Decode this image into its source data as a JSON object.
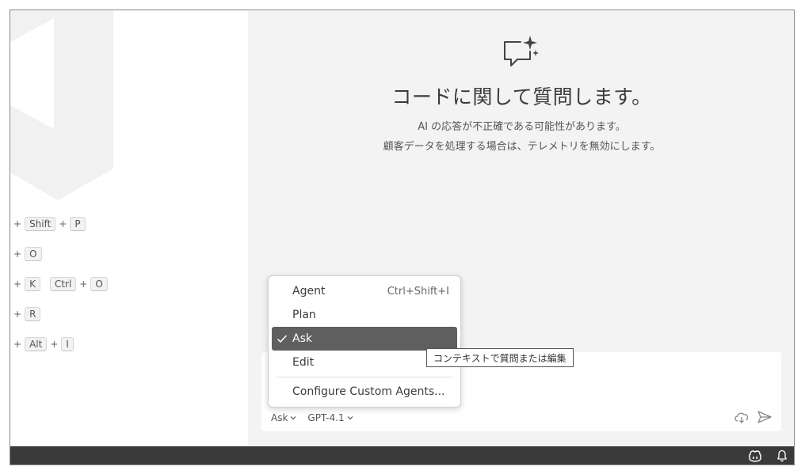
{
  "shortcuts": [
    {
      "items": [
        "+",
        "Shift",
        "+",
        "P"
      ]
    },
    {
      "items": [
        "+",
        "O"
      ]
    },
    {
      "items": [
        "+",
        "K",
        "Ctrl",
        "+",
        "O"
      ]
    },
    {
      "items": [
        "+",
        "R"
      ]
    },
    {
      "items": [
        "+",
        "Alt",
        "+",
        "I"
      ]
    }
  ],
  "chat": {
    "title": "コードに関して質問します。",
    "subtitle_1": "AI の応答が不正確である可能性があります。",
    "subtitle_2": "顧客データを処理する場合は、テレメトリを無効にします。",
    "mode_picker": "Ask",
    "model_picker": "GPT-4.1"
  },
  "mode_menu": {
    "items": [
      {
        "label": "Agent",
        "shortcut": "Ctrl+Shift+I",
        "selected": false
      },
      {
        "label": "Plan",
        "shortcut": "",
        "selected": false
      },
      {
        "label": "Ask",
        "shortcut": "",
        "selected": true
      },
      {
        "label": "Edit",
        "shortcut": "",
        "selected": false
      }
    ],
    "configure_label": "Configure Custom Agents..."
  },
  "tooltip": {
    "text": "コンテキストで質問または編集"
  },
  "icons": {
    "chat_header": "chat-sparkle-icon",
    "attach": "cloud-icon",
    "send": "send-icon",
    "copilot": "copilot-icon",
    "notifications": "bell-icon"
  }
}
